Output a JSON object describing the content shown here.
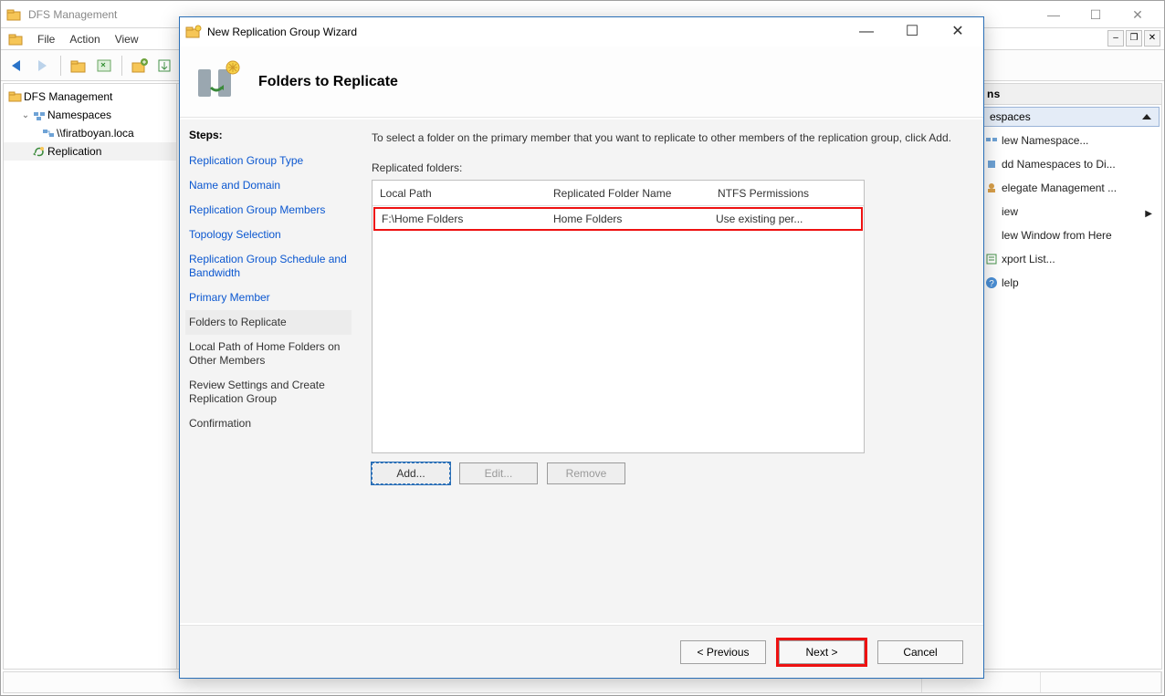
{
  "main": {
    "title": "DFS Management",
    "menus": [
      "File",
      "Action",
      "View"
    ],
    "tree": {
      "root": "DFS Management",
      "nodes": [
        {
          "label": "Namespaces",
          "children": [
            {
              "label": "\\\\firatboyan.loca"
            }
          ]
        },
        {
          "label": "Replication"
        }
      ]
    }
  },
  "actions": {
    "header": "ns",
    "section": "espaces",
    "items": [
      {
        "label": "lew Namespace..."
      },
      {
        "label": "dd Namespaces to Di..."
      },
      {
        "label": "elegate Management ..."
      },
      {
        "label": "iew",
        "hasSub": true
      },
      {
        "label": "lew Window from Here"
      },
      {
        "label": "xport List..."
      },
      {
        "label": "lelp"
      }
    ]
  },
  "wizard": {
    "title": "New Replication Group Wizard",
    "heading": "Folders to Replicate",
    "stepsTitle": "Steps:",
    "steps": [
      {
        "label": "Replication Group Type",
        "type": "link"
      },
      {
        "label": "Name and Domain",
        "type": "link"
      },
      {
        "label": "Replication Group Members",
        "type": "link"
      },
      {
        "label": "Topology Selection",
        "type": "link"
      },
      {
        "label": "Replication Group Schedule and Bandwidth",
        "type": "link"
      },
      {
        "label": "Primary Member",
        "type": "link"
      },
      {
        "label": "Folders to Replicate",
        "type": "current"
      },
      {
        "label": "Local Path of Home Folders on Other Members",
        "type": "plain"
      },
      {
        "label": "Review Settings and Create Replication Group",
        "type": "plain"
      },
      {
        "label": "Confirmation",
        "type": "plain"
      }
    ],
    "instruction": "To select a folder on the primary member that you want to replicate to other members of the replication group, click Add.",
    "rfLabel": "Replicated folders:",
    "columns": [
      "Local Path",
      "Replicated Folder Name",
      "NTFS Permissions"
    ],
    "rows": [
      {
        "localPath": "F:\\Home Folders",
        "name": "Home Folders",
        "perm": "Use existing per..."
      }
    ],
    "gridButtons": {
      "add": "Add...",
      "edit": "Edit...",
      "remove": "Remove"
    },
    "footer": {
      "prev": "< Previous",
      "next": "Next >",
      "cancel": "Cancel"
    }
  }
}
